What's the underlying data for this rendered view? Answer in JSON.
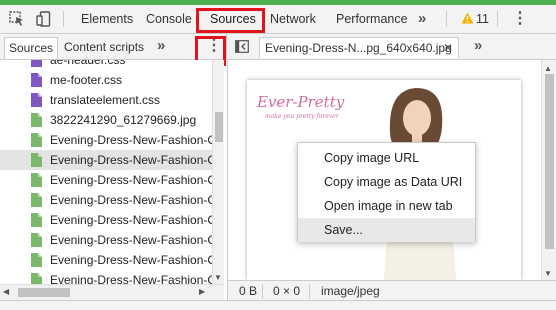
{
  "toolbar": {
    "tabs": [
      "Elements",
      "Console",
      "Sources",
      "Network",
      "Performance"
    ],
    "more_tabs_glyph": "»",
    "warning_count": "11",
    "menu_glyph": "⋮",
    "icons": [
      "inspect-icon",
      "device-toolbar-icon",
      "warning-icon",
      "more-menu-icon"
    ]
  },
  "navigator": {
    "tabs": [
      "Sources",
      "Content scripts"
    ],
    "more_glyph": "»",
    "menu_glyph": "⋮"
  },
  "editor": {
    "file_tab": "Evening-Dress-N...pg_640x640.jpg",
    "more_glyph": "»"
  },
  "files": [
    {
      "name": "ae-header.css",
      "type": "css"
    },
    {
      "name": "me-footer.css",
      "type": "css"
    },
    {
      "name": "translateelement.css",
      "type": "css"
    },
    {
      "name": "3822241290_61279669.jpg",
      "type": "image"
    },
    {
      "name": "Evening-Dress-New-Fashion-C",
      "type": "image"
    },
    {
      "name": "Evening-Dress-New-Fashion-C",
      "type": "image",
      "selected": true
    },
    {
      "name": "Evening-Dress-New-Fashion-C",
      "type": "image"
    },
    {
      "name": "Evening-Dress-New-Fashion-C",
      "type": "image"
    },
    {
      "name": "Evening-Dress-New-Fashion-C",
      "type": "image"
    },
    {
      "name": "Evening-Dress-New-Fashion-C",
      "type": "image"
    },
    {
      "name": "Evening-Dress-New-Fashion-C",
      "type": "image"
    },
    {
      "name": "Evening-Dress-New-Fashion-C",
      "type": "image"
    }
  ],
  "context_menu": {
    "items": [
      "Copy image URL",
      "Copy image as Data URI",
      "Open image in new tab",
      "Save..."
    ],
    "highlighted_index": 3
  },
  "preview": {
    "logo_text": "Ever-Pretty",
    "tagline": "make you pretty forever"
  },
  "status": {
    "size": "0 B",
    "dimensions": "0 × 0",
    "mime": "image/jpeg"
  },
  "colors": {
    "highlight": "#e0141c",
    "css_file": "#7e57c2",
    "image_file": "#7cb86a",
    "top_bar": "#4caf50",
    "logo": "#d26aa0"
  }
}
